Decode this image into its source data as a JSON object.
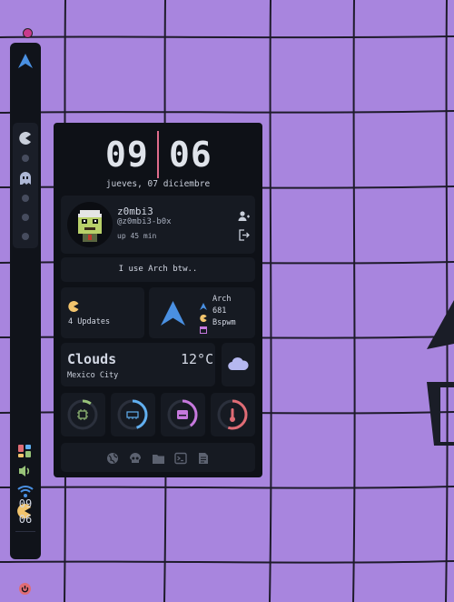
{
  "colors": {
    "accent": "#4a90e2",
    "pink": "#e06c8b",
    "yellow": "#f2c46d",
    "green": "#98c379",
    "blue": "#61afef",
    "purple": "#c678dd",
    "red": "#e06c75",
    "bar_bg": "#10131a",
    "card_bg": "#161a22"
  },
  "bar": {
    "icons": [
      "arch-logo-icon",
      "pacman-icon",
      "ghost-icon",
      "layout-icon",
      "volume-icon",
      "wifi-icon",
      "pacman-battery-icon",
      "power-icon"
    ],
    "clock": {
      "hour": "09",
      "minute": "06"
    }
  },
  "dashboard": {
    "clock": {
      "hour": "09",
      "minute": "06",
      "date": "jueves, 07 diciembre"
    },
    "profile": {
      "name": "z0mbi3",
      "handle": "@z0mbi3-b0x",
      "uptime": "up 45 min",
      "avatar": "zombie-pixel-avatar"
    },
    "motto": "I use Arch btw..",
    "updates": {
      "text": "4 Updates",
      "icon": "pacman-icon"
    },
    "system": {
      "distro": "Arch",
      "packages": "681",
      "wm": "Bspwm"
    },
    "weather": {
      "condition": "Clouds",
      "temp": "12°C",
      "city": "Mexico City",
      "icon": "cloud-icon"
    },
    "stats": [
      {
        "name": "cpu",
        "icon": "cpu-icon",
        "fraction": 0.1,
        "color": "#98c379"
      },
      {
        "name": "ram",
        "icon": "memory-icon",
        "fraction": 0.45,
        "color": "#61afef"
      },
      {
        "name": "disk",
        "icon": "disk-icon",
        "fraction": 0.4,
        "color": "#c678dd"
      },
      {
        "name": "temp",
        "icon": "thermometer-icon",
        "fraction": 0.55,
        "color": "#e06c75"
      }
    ],
    "dock": [
      "globe-icon",
      "skull-icon",
      "folder-icon",
      "terminal-icon",
      "notes-icon"
    ]
  }
}
